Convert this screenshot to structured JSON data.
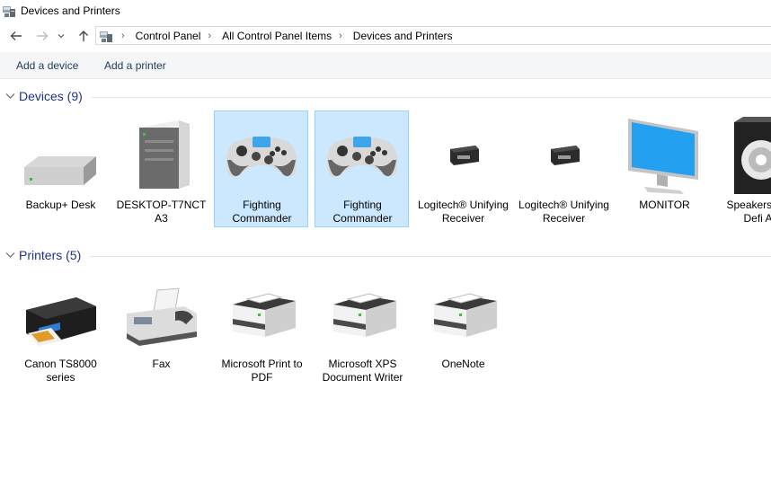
{
  "window": {
    "title": "Devices and Printers"
  },
  "breadcrumb": [
    "Control Panel",
    "All Control Panel Items",
    "Devices and Printers"
  ],
  "commands": {
    "add_device": "Add a device",
    "add_printer": "Add a printer"
  },
  "devices_group": {
    "title": "Devices (9)",
    "items": [
      {
        "label": "Backup+  Desk",
        "icon": "external-drive-icon"
      },
      {
        "label": "DESKTOP-T7NCT A3",
        "icon": "computer-tower-icon"
      },
      {
        "label": "Fighting Commander",
        "icon": "gamepad-icon",
        "selected": true
      },
      {
        "label": "Fighting Commander",
        "icon": "gamepad-icon",
        "selected": true
      },
      {
        "label": "Logitech® Unifying Receiver",
        "icon": "usb-receiver-icon"
      },
      {
        "label": "Logitech® Unifying Receiver",
        "icon": "usb-receiver-icon"
      },
      {
        "label": "MONITOR",
        "icon": "monitor-icon"
      },
      {
        "label": "Speakers ( High Defi Audi",
        "icon": "speaker-icon"
      }
    ]
  },
  "printers_group": {
    "title": "Printers (5)",
    "items": [
      {
        "label": "Canon TS8000 series",
        "icon": "inkjet-printer-icon"
      },
      {
        "label": "Fax",
        "icon": "fax-icon"
      },
      {
        "label": "Microsoft Print to PDF",
        "icon": "printer-icon"
      },
      {
        "label": "Microsoft XPS Document Writer",
        "icon": "printer-icon"
      },
      {
        "label": "OneNote",
        "icon": "printer-icon"
      }
    ]
  },
  "colors": {
    "accent": "#1e3287",
    "selection_bg": "#cce8ff",
    "selection_border": "#99d1ff"
  }
}
